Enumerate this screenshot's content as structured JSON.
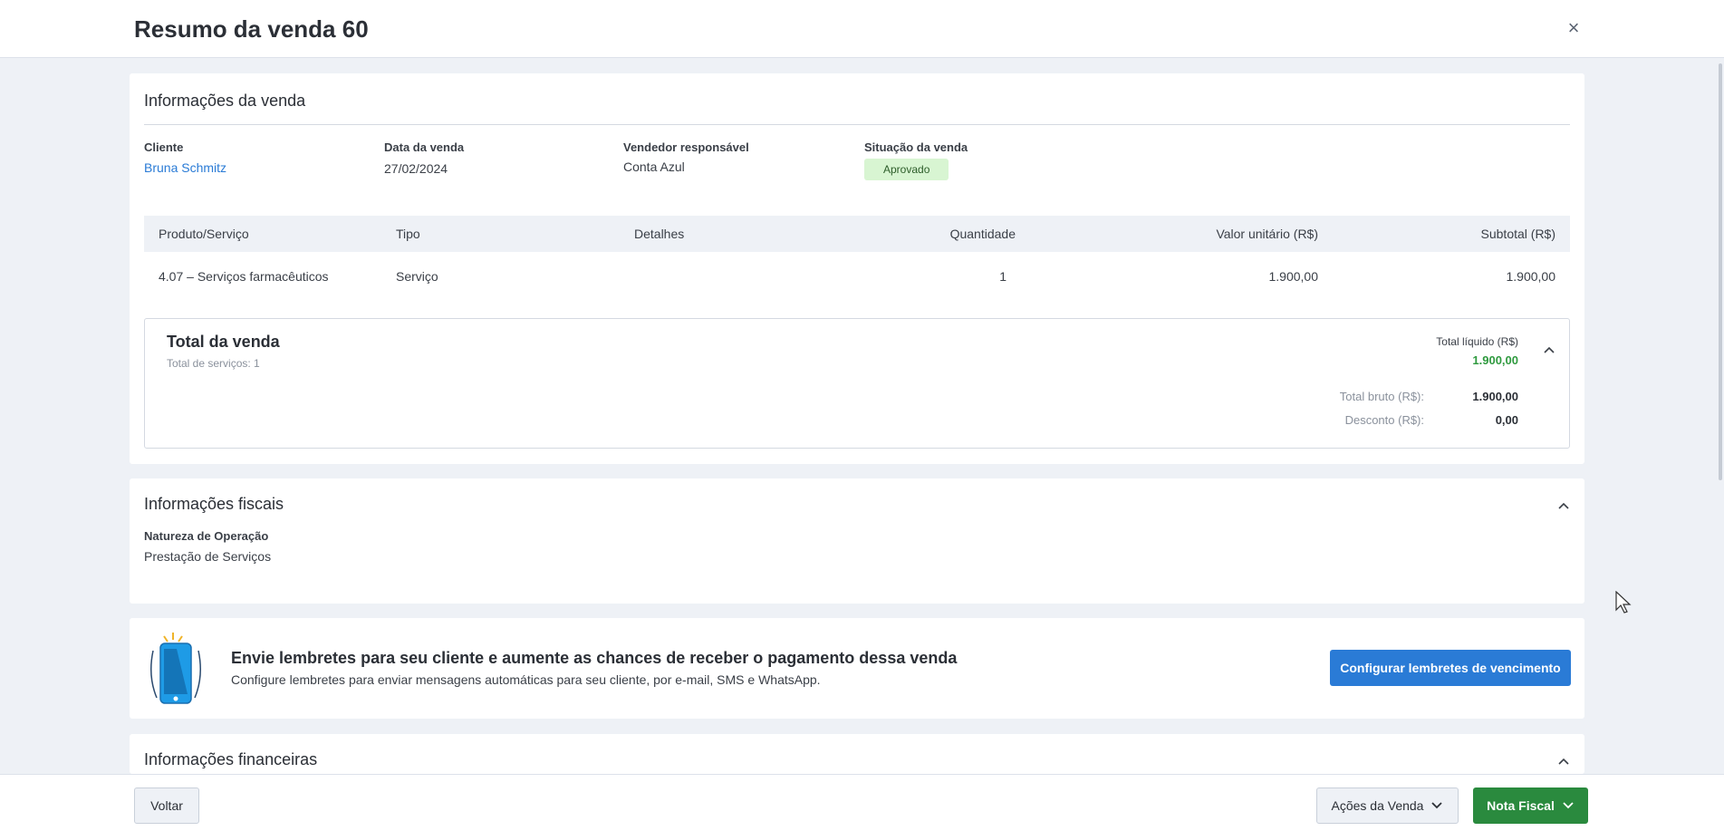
{
  "header": {
    "title": "Resumo da venda 60",
    "close_label": "×"
  },
  "sale_info": {
    "title": "Informações da venda",
    "client": {
      "label": "Cliente",
      "value": "Bruna Schmitz"
    },
    "date": {
      "label": "Data da venda",
      "value": "27/02/2024"
    },
    "seller": {
      "label": "Vendedor responsável",
      "value": "Conta Azul"
    },
    "status": {
      "label": "Situação da venda",
      "value": "Aprovado"
    },
    "table": {
      "headers": [
        "Produto/Serviço",
        "Tipo",
        "Detalhes",
        "Quantidade",
        "Valor unitário (R$)",
        "Subtotal (R$)"
      ],
      "rows": [
        {
          "product": "4.07 – Serviços farmacêuticos",
          "type": "Serviço",
          "details": "",
          "quantity": "1",
          "unit_value": "1.900,00",
          "subtotal": "1.900,00"
        }
      ]
    },
    "total": {
      "title": "Total da venda",
      "subtitle": "Total de serviços: 1",
      "net_label": "Total líquido (R$)",
      "net_value": "1.900,00",
      "gross_label": "Total bruto (R$):",
      "gross_value": "1.900,00",
      "discount_label": "Desconto (R$):",
      "discount_value": "0,00"
    }
  },
  "fiscal": {
    "title": "Informações fiscais",
    "nature_label": "Natureza de Operação",
    "nature_value": "Prestação de Serviços"
  },
  "promo": {
    "title": "Envie lembretes para seu cliente e aumente as chances de receber o pagamento dessa venda",
    "subtitle": "Configure lembretes para enviar mensagens automáticas para seu cliente, por e-mail, SMS e WhatsApp.",
    "button": "Configurar lembretes de vencimento"
  },
  "financial": {
    "title": "Informações financeiras"
  },
  "footer": {
    "back": "Voltar",
    "actions": "Ações da Venda",
    "invoice": "Nota Fiscal"
  },
  "colors": {
    "primary": "#2a7bd6",
    "success": "#2a8a3e",
    "net_value": "#2f9a3f",
    "badge_bg": "#d8f5d2"
  }
}
